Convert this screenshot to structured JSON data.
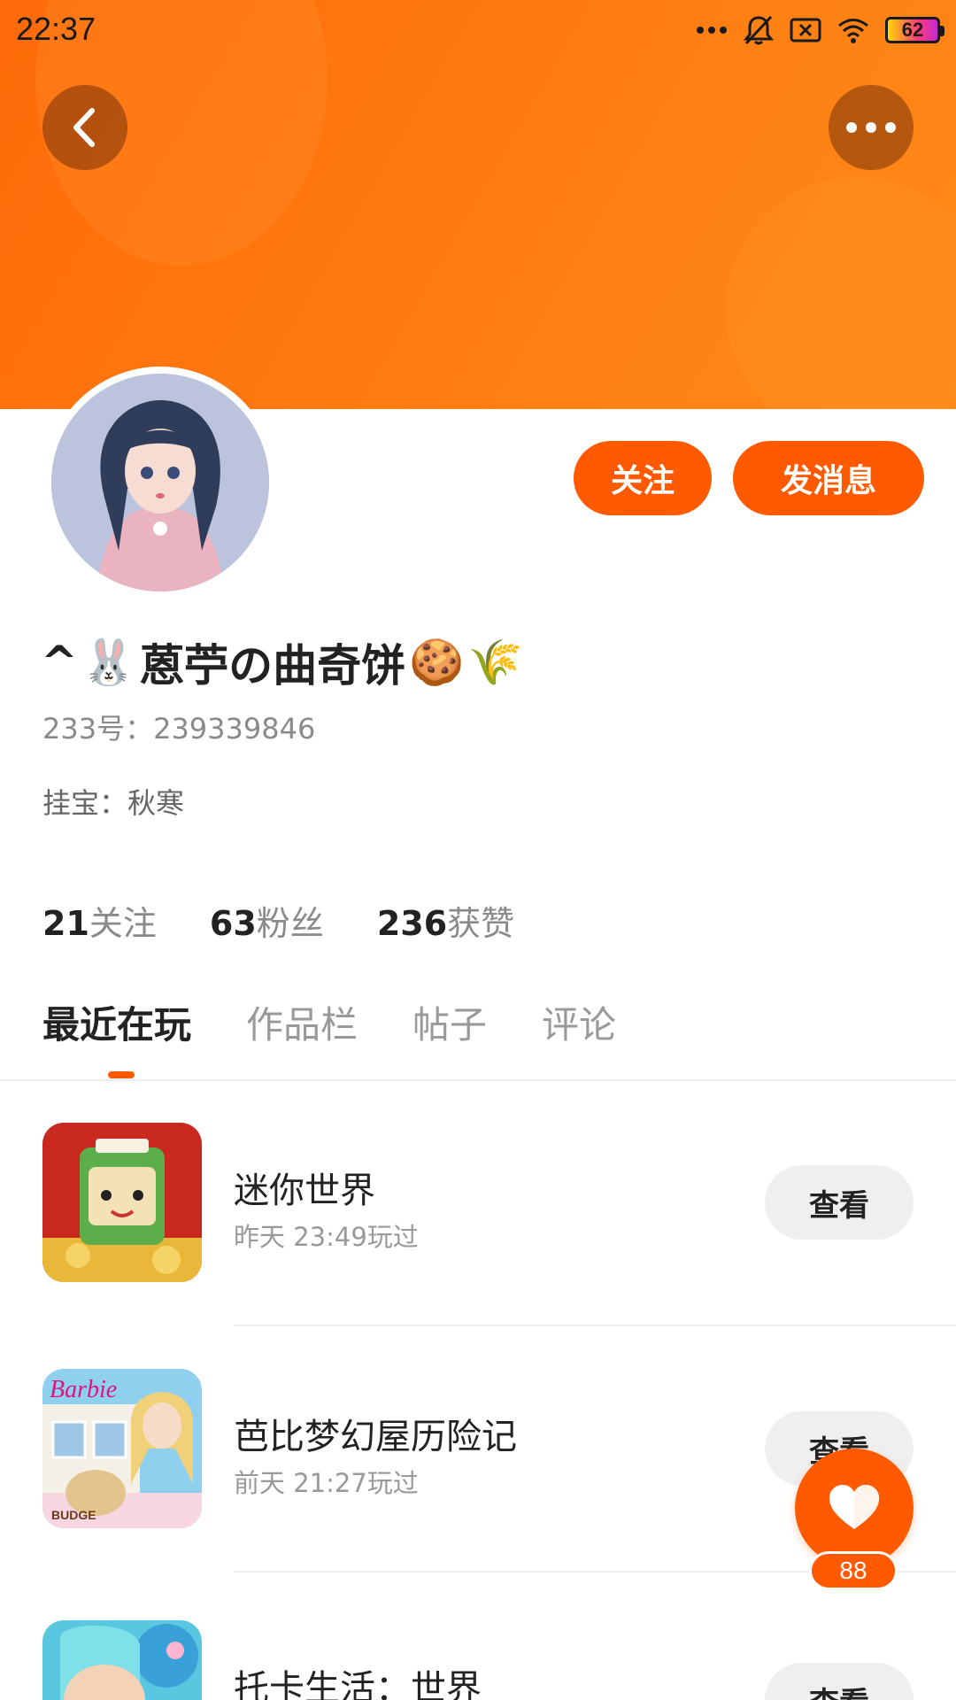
{
  "status_bar": {
    "time": "22:37",
    "battery_level": "62",
    "icons": [
      "more-dots-icon",
      "mute-bell-icon",
      "no-sim-icon",
      "wifi-icon",
      "battery-icon"
    ]
  },
  "header": {
    "back_icon": "chevron-left-icon",
    "more_icon": "more-horizontal-icon",
    "accent_color": "#ff5a00"
  },
  "profile": {
    "name_prefix": "^",
    "name_emoji_1": "🐰",
    "name_text": "蒽苧の曲奇饼",
    "name_emoji_2": "🍪",
    "name_emoji_3": "🌾",
    "uid": "233号：239339846",
    "pet": "挂宝：秋寒"
  },
  "actions": {
    "follow_label": "关注",
    "message_label": "发消息"
  },
  "stats": [
    {
      "num": "21",
      "label": "关注"
    },
    {
      "num": "63",
      "label": "粉丝"
    },
    {
      "num": "236",
      "label": "获赞"
    }
  ],
  "tabs": [
    {
      "label": "最近在玩",
      "active": true
    },
    {
      "label": "作品栏",
      "active": false
    },
    {
      "label": "帖子",
      "active": false
    },
    {
      "label": "评论",
      "active": false
    }
  ],
  "games": [
    {
      "title": "迷你世界",
      "time": "昨天 23:49玩过",
      "button": "查看"
    },
    {
      "title": "芭比梦幻屋历险记",
      "time": "前天 21:27玩过",
      "button": "查看"
    },
    {
      "title": "托卡生活：世界",
      "time": "",
      "button": "查看"
    }
  ],
  "like": {
    "count": "88",
    "icon": "heart-icon"
  }
}
